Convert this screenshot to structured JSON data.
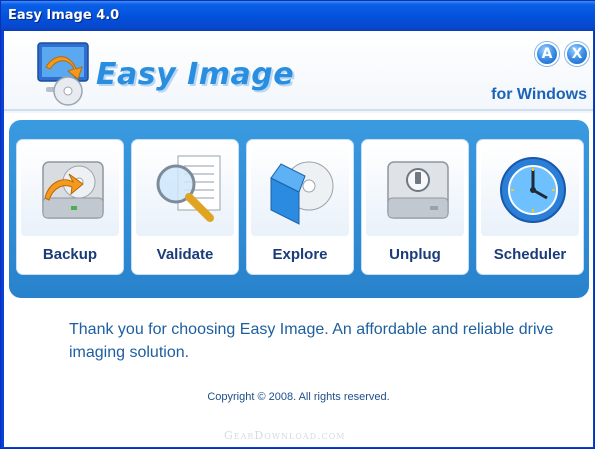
{
  "window": {
    "title": "Easy Image 4.0"
  },
  "header": {
    "app_name": "Easy Image",
    "platform": "for Windows",
    "about_button": "A",
    "close_button": "X"
  },
  "toolbar": {
    "items": [
      {
        "label": "Backup",
        "icon": "backup-drive-icon"
      },
      {
        "label": "Validate",
        "icon": "magnifier-document-icon"
      },
      {
        "label": "Explore",
        "icon": "folder-disc-icon"
      },
      {
        "label": "Unplug",
        "icon": "drive-power-icon"
      },
      {
        "label": "Scheduler",
        "icon": "clock-icon"
      }
    ]
  },
  "message": "Thank you for choosing Easy Image. An affordable and reliable drive imaging solution.",
  "copyright": "Copyright © 2008. All rights reserved.",
  "watermark": "GearDownload.com",
  "colors": {
    "titlebar": "#0453dc",
    "accent": "#2a8ee0",
    "panel": "#2e8fd6",
    "label": "#1b3c78",
    "message": "#1d5fa0"
  }
}
